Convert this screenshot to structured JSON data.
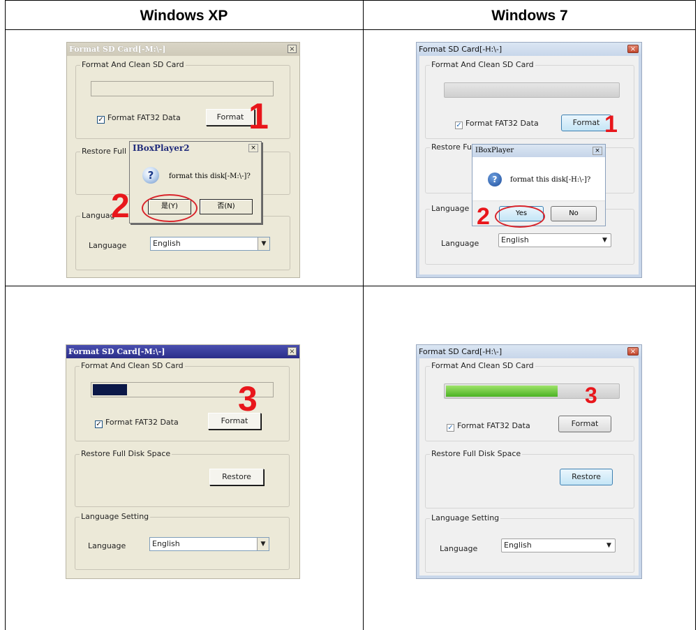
{
  "headers": {
    "xp": "Windows XP",
    "win7": "Windows 7"
  },
  "xp_top": {
    "title": "Format SD Card[-M:\\-]",
    "group_format": "Format And Clean SD Card",
    "checkbox_label": "Format FAT32 Data",
    "format_button": "Format",
    "group_restore": "Restore Full D",
    "group_language": "Languag",
    "language_label": "Language",
    "language_value": "English",
    "step": "1",
    "dialog": {
      "title": "IBoxPlayer2",
      "message": "format this disk[-M:\\-]?",
      "yes": "是(Y)",
      "no": "否(N)",
      "step": "2"
    }
  },
  "w7_top": {
    "title": "Format SD Card[-H:\\-]",
    "group_format": "Format And Clean SD Card",
    "checkbox_label": "Format FAT32 Data",
    "format_button": "Format",
    "group_restore": "Restore Fu",
    "group_language": "Language S",
    "language_label": "Language",
    "language_value": "English",
    "step": "1",
    "dialog": {
      "title": "IBoxPlayer",
      "message": "format this disk[-H:\\-]?",
      "yes": "Yes",
      "no": "No",
      "step": "2"
    }
  },
  "xp_bottom": {
    "title": "Format SD Card[-M:\\-]",
    "group_format": "Format And Clean SD Card",
    "progress_fraction": 0.19,
    "checkbox_label": "Format FAT32 Data",
    "format_button": "Format",
    "group_restore": "Restore Full Disk Space",
    "restore_button": "Restore",
    "group_language": "Language Setting",
    "language_label": "Language",
    "language_value": "English",
    "step": "3"
  },
  "w7_bottom": {
    "title": "Format SD Card[-H:\\-]",
    "group_format": "Format And Clean SD Card",
    "progress_fraction": 0.64,
    "checkbox_label": "Format FAT32 Data",
    "format_button": "Format",
    "group_restore": "Restore Full Disk Space",
    "restore_button": "Restore",
    "group_language": "Language Setting",
    "language_label": "Language",
    "language_value": "English",
    "step": "3"
  },
  "colors": {
    "step_number": "#e8161b",
    "xp_progress": "#0b1848",
    "w7_progress": "#4bb224"
  }
}
